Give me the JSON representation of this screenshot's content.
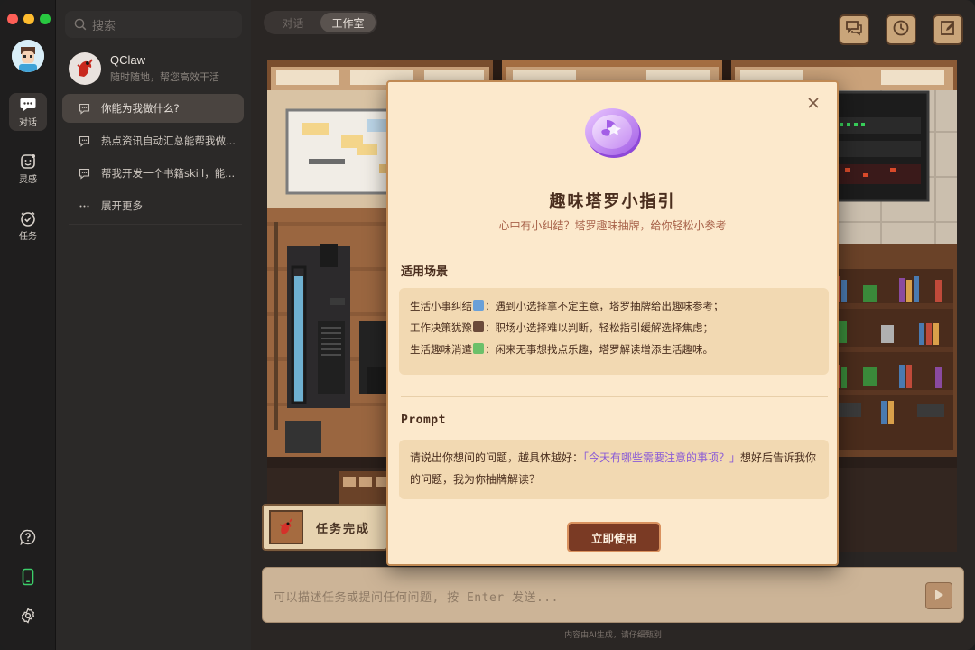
{
  "window": {
    "controls": [
      "close",
      "minimize",
      "maximize"
    ]
  },
  "rail": {
    "items": [
      {
        "label": "对话",
        "icon": "chat-bubble-icon",
        "active": true
      },
      {
        "label": "灵感",
        "icon": "inspiration-icon",
        "active": false
      },
      {
        "label": "任务",
        "icon": "task-check-icon",
        "active": false
      }
    ],
    "bottom_icons": [
      "help-icon",
      "phone-icon",
      "settings-icon"
    ]
  },
  "panel": {
    "search_placeholder": "搜索",
    "contact": {
      "name": "QClaw",
      "subtitle": "随时随地，帮您高效干活"
    },
    "conversations": [
      {
        "label": "你能为我做什么?",
        "active": true
      },
      {
        "label": "热点资讯自动汇总能帮我做...",
        "active": false
      },
      {
        "label": "帮我开发一个书籍skill，能...",
        "active": false
      }
    ],
    "more_label": "展开更多"
  },
  "main": {
    "tabs": [
      {
        "label": "对话",
        "active": false
      },
      {
        "label": "工作室",
        "active": true
      }
    ],
    "top_buttons": [
      "chat-icon",
      "clock-icon",
      "edit-icon"
    ],
    "task_card": {
      "label": "任务完成"
    },
    "composer": {
      "placeholder": "可以描述任务或提问任何问题, 按 Enter 发送..."
    },
    "disclaimer": "内容由AI生成，请仔细甄别"
  },
  "modal": {
    "title": "趣味塔罗小指引",
    "subtitle": "心中有小纠结？塔罗趣味抽牌，给你轻松小参考",
    "scenarios_title": "适用场景",
    "scenarios": [
      {
        "label": "生活小事纠结",
        "text": "：遇到小选择拿不定主意，塔罗抽牌给出趣味参考；"
      },
      {
        "label": "工作决策犹豫",
        "text": "：职场小选择难以判断，轻松指引缓解选择焦虑；"
      },
      {
        "label": "生活趣味消遣",
        "text": "：闲来无事想找点乐趣，塔罗解读增添生活趣味。"
      }
    ],
    "prompt_title": "Prompt",
    "prompt": {
      "before": "请说出你想问的问题，越具体越好：",
      "highlight": "「今天有哪些需要注意的事项？」",
      "after": "想好后告诉我你的问题，我为你抽牌解读？"
    },
    "button_label": "立即使用"
  }
}
